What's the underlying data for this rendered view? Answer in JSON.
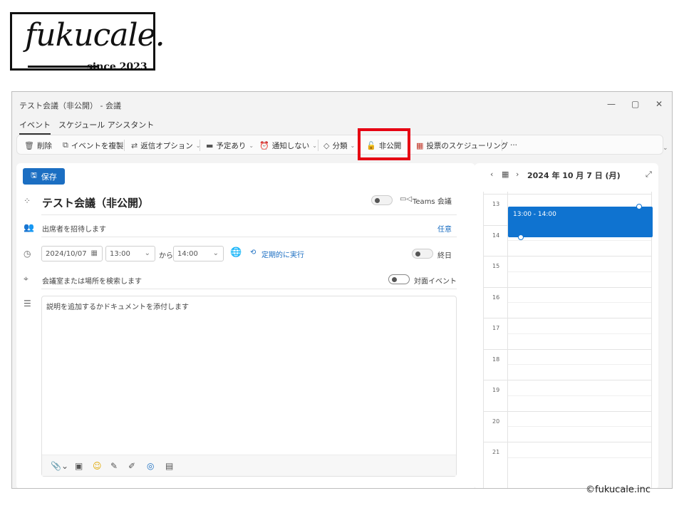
{
  "logo": {
    "script": "fukucale.",
    "since": "since 2023"
  },
  "window": {
    "title": "テスト会議（非公開） - 会議",
    "controls": {
      "minimize": "—",
      "maximize": "▢",
      "close": "✕"
    }
  },
  "tabs": [
    {
      "label": "イベント",
      "active": true
    },
    {
      "label": "スケジュール アシスタント",
      "active": false
    }
  ],
  "toolbar": {
    "delete": "削除",
    "copy_event": "イベントを複製",
    "response_options": "返信オプション",
    "busy": "予定あり",
    "no_reminder": "通知しない",
    "categorize": "分類",
    "private": "非公開",
    "poll": "投票のスケジューリング",
    "more": "···"
  },
  "form": {
    "save": "保存",
    "subject": "テスト会議（非公開）",
    "teams_label": "Teams 会議",
    "attendees_placeholder": "出席者を招待します",
    "optional": "任意",
    "date": "2024/10/07",
    "start_time": "13:00",
    "to": "から",
    "end_time": "14:00",
    "recurring": "定期的に実行",
    "all_day": "終日",
    "location_placeholder": "会議室または場所を検索します",
    "in_person": "対面イベント",
    "description_placeholder": "説明を追加するかドキュメントを添付します"
  },
  "calendar": {
    "date_label": "2024 年 10 月 7 日 (月)",
    "hours": [
      "13",
      "14",
      "15",
      "16",
      "17",
      "18",
      "19",
      "20",
      "21"
    ],
    "event_time": "13:00 - 14:00"
  },
  "copyright": "©fukucale.inc",
  "colors": {
    "accent": "#1b6ec2",
    "event": "#0f73d0",
    "highlight": "#e60012"
  }
}
